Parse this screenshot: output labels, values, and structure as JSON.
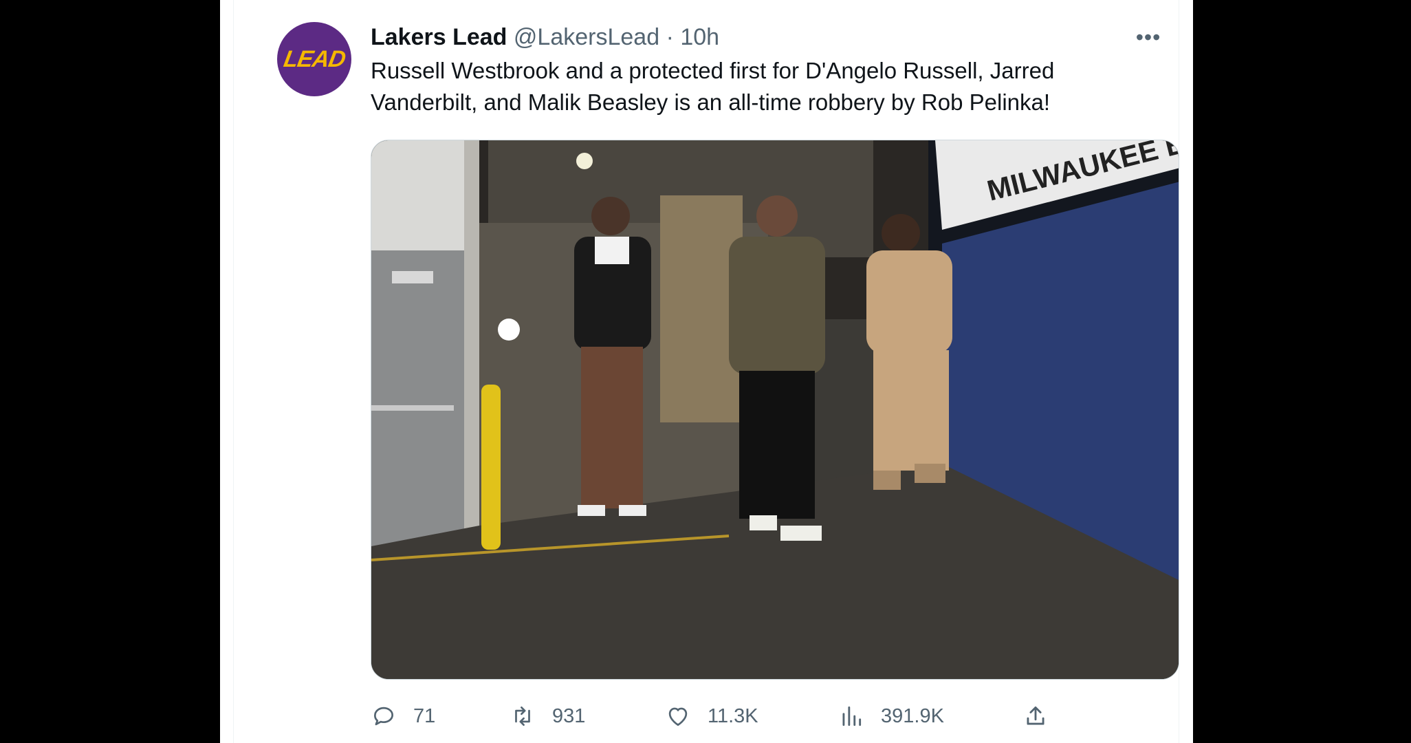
{
  "tweet": {
    "avatar_text": "LEAD",
    "display_name": "Lakers Lead",
    "handle": "@LakersLead",
    "separator": "·",
    "time": "10h",
    "more_icon": "more-horizontal-icon",
    "more_label": "•••",
    "text": "Russell Westbrook and a protected first for D'Angelo Russell, Jarred Vanderbilt, and Malik Beasley is an all-time robbery by Rob Pelinka!",
    "photo": {
      "sign_text": "MILWAUKEE BU"
    },
    "actions": {
      "reply": {
        "icon": "reply-icon",
        "count": "71"
      },
      "retweet": {
        "icon": "retweet-icon",
        "count": "931"
      },
      "like": {
        "icon": "heart-icon",
        "count": "11.3K"
      },
      "views": {
        "icon": "views-chart-icon",
        "count": "391.9K"
      },
      "share": {
        "icon": "share-icon"
      }
    }
  },
  "colors": {
    "background": "#000000",
    "panel": "#ffffff",
    "text_primary": "#0f1419",
    "text_secondary": "#536471",
    "avatar_purple": "#5c2a84",
    "avatar_gold": "#f5b800"
  }
}
